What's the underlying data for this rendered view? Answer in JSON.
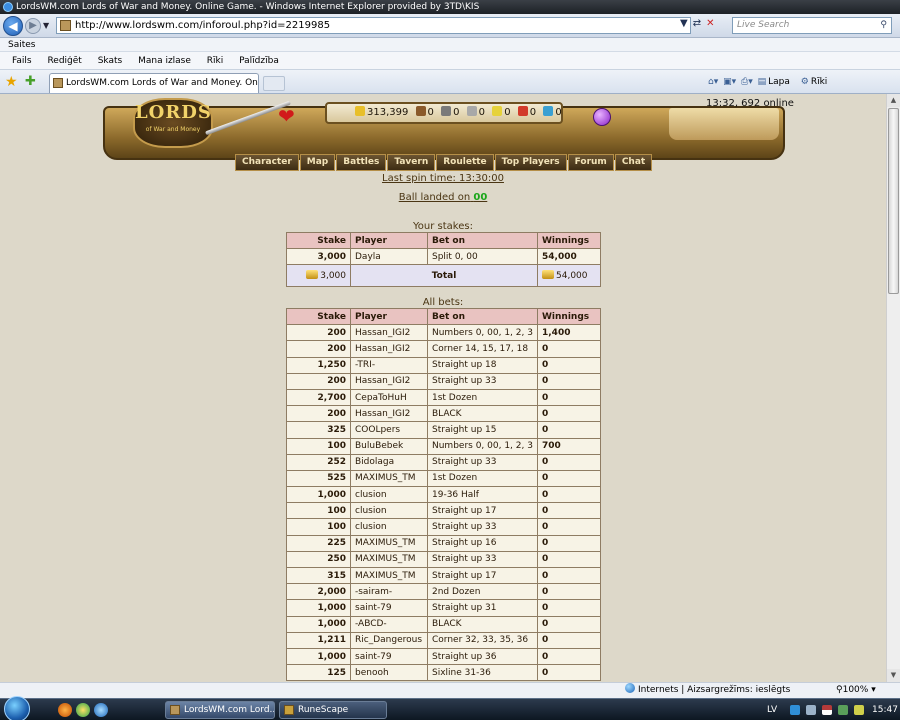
{
  "window": {
    "title": "LordsWM.com Lords of War and Money. Online Game. - Windows Internet Explorer provided by 3TD\\KIS"
  },
  "address": {
    "url": "http://www.lordswm.com/inforoul.php?id=2219985",
    "search_placeholder": "Live Search"
  },
  "links_bar": {
    "label": "Saites"
  },
  "menu": [
    "Fails",
    "Rediģēt",
    "Skats",
    "Mana izlase",
    "Rīki",
    "Palīdzība"
  ],
  "tab": {
    "label": "LordsWM.com Lords of War and Money. Online ..."
  },
  "commands": {
    "page": "Lapa",
    "tools": "Rīki"
  },
  "game": {
    "logo_big": "LORDS",
    "logo_small": "of War and Money",
    "resources": [
      {
        "name": "gold",
        "value": "313,399",
        "color": "#e8bf2a"
      },
      {
        "name": "wood",
        "value": "0",
        "color": "#8a5a2b"
      },
      {
        "name": "ore",
        "value": "0",
        "color": "#7a7a7a"
      },
      {
        "name": "mercury",
        "value": "0",
        "color": "#a8a8a8"
      },
      {
        "name": "sulfur",
        "value": "0",
        "color": "#e6d23a"
      },
      {
        "name": "crystals",
        "value": "0",
        "color": "#d23a2a"
      },
      {
        "name": "gems",
        "value": "0",
        "color": "#3aa0d2"
      }
    ],
    "time_online": "13:32, 692 online",
    "nav": [
      "Character",
      "Map",
      "Battles",
      "Tavern",
      "Roulette",
      "Top Players",
      "Forum",
      "Chat"
    ]
  },
  "roulette": {
    "last_spin": "Last spin time: 13:30:00",
    "ball_prefix": "Ball landed on",
    "ball_value": "00",
    "your_stakes_caption": "Your stakes:",
    "all_bets_caption": "All bets:",
    "headers": {
      "stake": "Stake",
      "player": "Player",
      "bet_on": "Bet on",
      "winnings": "Winnings"
    },
    "your_stakes": [
      {
        "stake": "3,000",
        "player": "Dayla",
        "bet": "Split 0, 00",
        "win": "54,000"
      }
    ],
    "total": {
      "stake": "3,000",
      "label": "Total",
      "win": "54,000"
    },
    "all_bets": [
      {
        "stake": "200",
        "player": "Hassan_IGI2",
        "bet": "Numbers 0, 00, 1, 2, 3",
        "win": "1,400"
      },
      {
        "stake": "200",
        "player": "Hassan_IGI2",
        "bet": "Corner 14, 15, 17, 18",
        "win": "0"
      },
      {
        "stake": "1,250",
        "player": "-TRI-",
        "bet": "Straight up 18",
        "win": "0"
      },
      {
        "stake": "200",
        "player": "Hassan_IGI2",
        "bet": "Straight up 33",
        "win": "0"
      },
      {
        "stake": "2,700",
        "player": "CepaToHuH",
        "bet": "1st Dozen",
        "win": "0"
      },
      {
        "stake": "200",
        "player": "Hassan_IGI2",
        "bet": "BLACK",
        "win": "0"
      },
      {
        "stake": "325",
        "player": "COOLpers",
        "bet": "Straight up 15",
        "win": "0"
      },
      {
        "stake": "100",
        "player": "BuluBebek",
        "bet": "Numbers 0, 00, 1, 2, 3",
        "win": "700"
      },
      {
        "stake": "252",
        "player": "Bidolaga",
        "bet": "Straight up 33",
        "win": "0"
      },
      {
        "stake": "525",
        "player": "MAXIMUS_TM",
        "bet": "1st Dozen",
        "win": "0"
      },
      {
        "stake": "1,000",
        "player": "clusion",
        "bet": "19-36 Half",
        "win": "0"
      },
      {
        "stake": "100",
        "player": "clusion",
        "bet": "Straight up 17",
        "win": "0"
      },
      {
        "stake": "100",
        "player": "clusion",
        "bet": "Straight up 33",
        "win": "0"
      },
      {
        "stake": "225",
        "player": "MAXIMUS_TM",
        "bet": "Straight up 16",
        "win": "0"
      },
      {
        "stake": "250",
        "player": "MAXIMUS_TM",
        "bet": "Straight up 33",
        "win": "0"
      },
      {
        "stake": "315",
        "player": "MAXIMUS_TM",
        "bet": "Straight up 17",
        "win": "0"
      },
      {
        "stake": "2,000",
        "player": "-sairam-",
        "bet": "2nd Dozen",
        "win": "0"
      },
      {
        "stake": "1,000",
        "player": "saint-79",
        "bet": "Straight up 31",
        "win": "0"
      },
      {
        "stake": "1,000",
        "player": "-ABCD-",
        "bet": "BLACK",
        "win": "0"
      },
      {
        "stake": "1,211",
        "player": "Ric_Dangerous",
        "bet": "Corner 32, 33, 35, 36",
        "win": "0"
      },
      {
        "stake": "1,000",
        "player": "saint-79",
        "bet": "Straight up 36",
        "win": "0"
      },
      {
        "stake": "125",
        "player": "benooh",
        "bet": "Sixline 31-36",
        "win": "0"
      }
    ]
  },
  "status": {
    "zone": "Internets | Aizsargrežīms: ieslēgts",
    "zoom": "100%"
  },
  "taskbar": {
    "tasks": [
      "LordsWM.com Lord...",
      "RuneScape"
    ],
    "lang": "LV",
    "clock": "15:47"
  }
}
